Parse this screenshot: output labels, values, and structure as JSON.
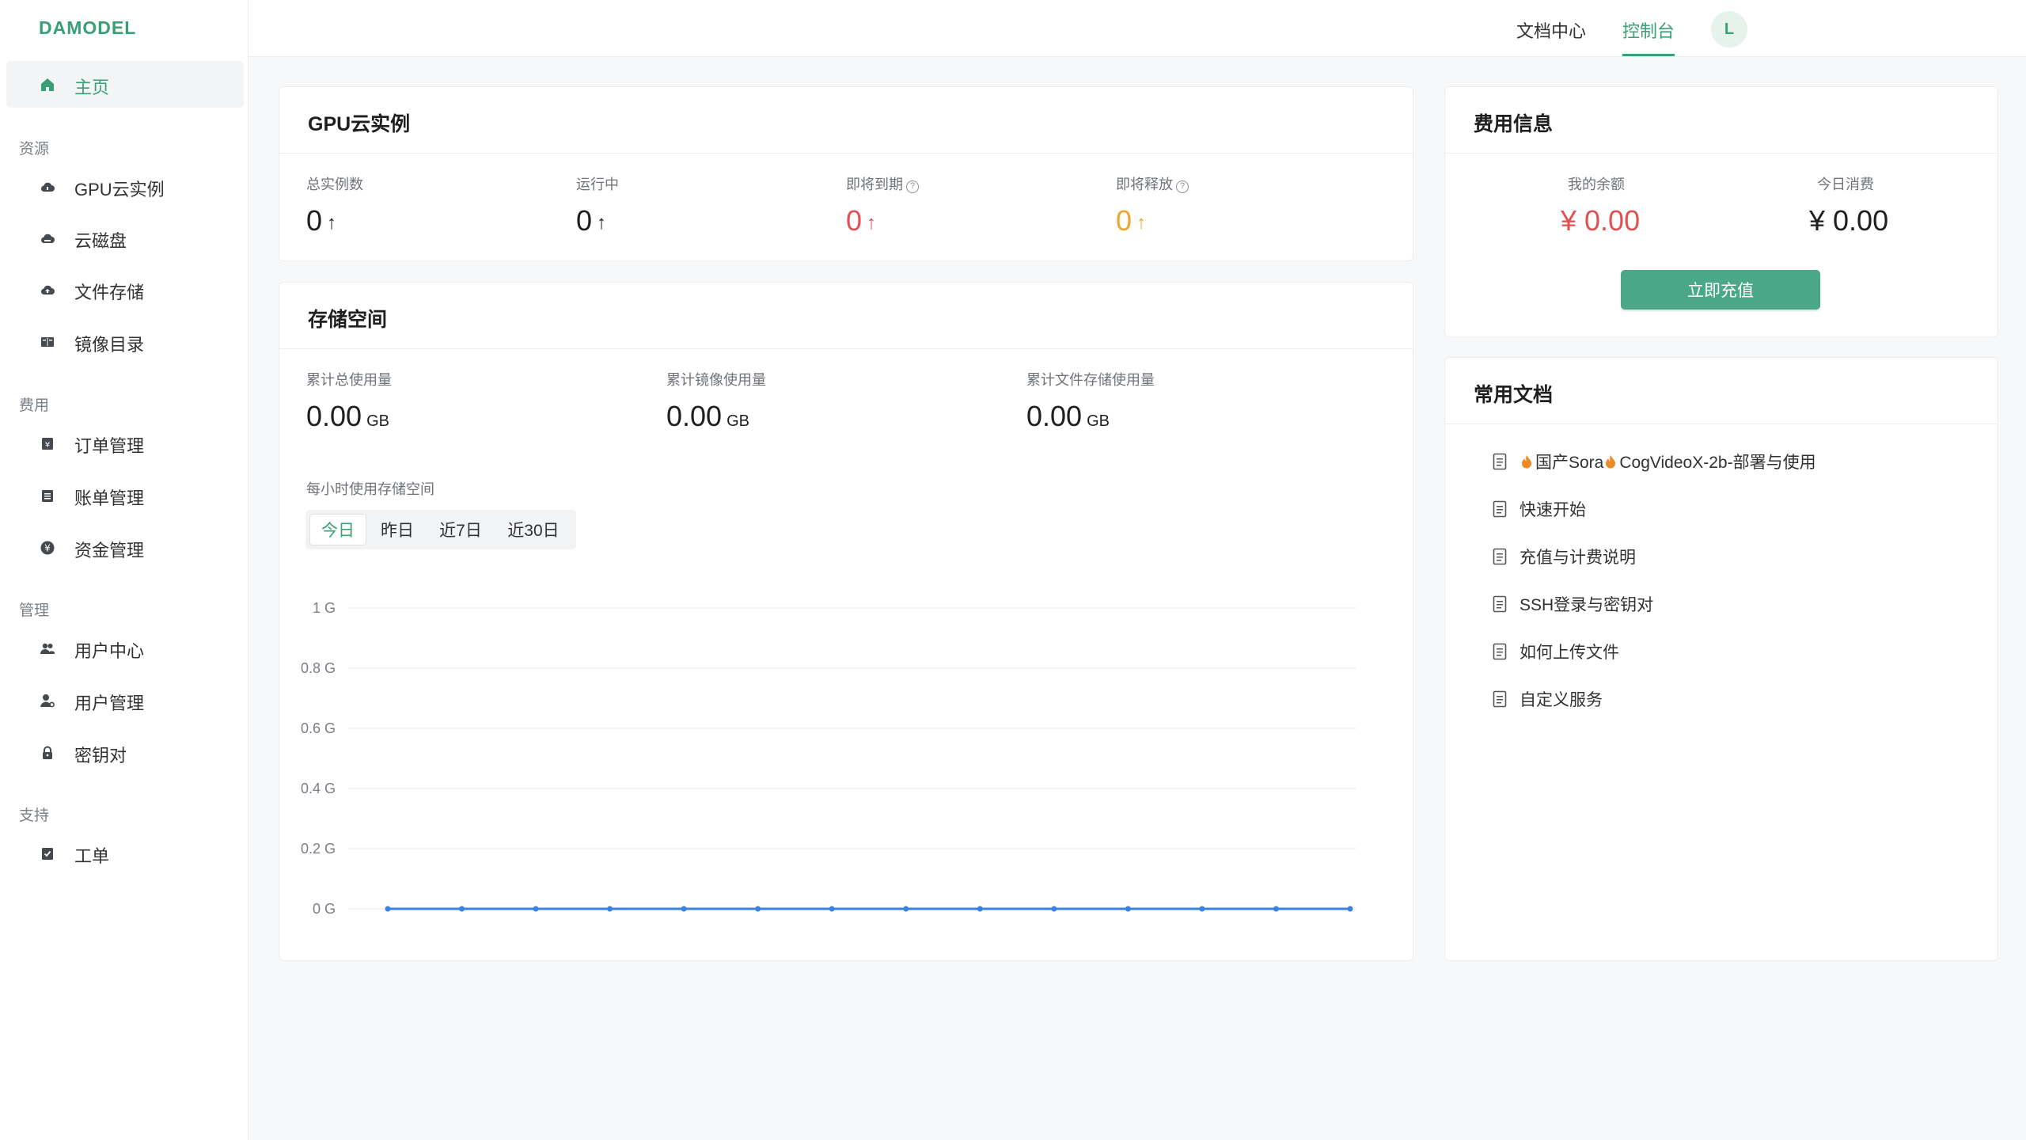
{
  "brand": {
    "logo": "DAMODEL",
    "accent": "#3a9f76"
  },
  "sidebar": {
    "home": {
      "label": "主页",
      "icon": "home-icon"
    },
    "sections": [
      {
        "title": "资源",
        "items": [
          {
            "label": "GPU云实例",
            "icon": "cloud-icon"
          },
          {
            "label": "云磁盘",
            "icon": "cloud-disk-icon"
          },
          {
            "label": "文件存储",
            "icon": "cloud-upload-icon"
          },
          {
            "label": "镜像目录",
            "icon": "book-icon"
          }
        ]
      },
      {
        "title": "费用",
        "items": [
          {
            "label": "订单管理",
            "icon": "order-icon"
          },
          {
            "label": "账单管理",
            "icon": "bill-icon"
          },
          {
            "label": "资金管理",
            "icon": "yen-icon"
          }
        ]
      },
      {
        "title": "管理",
        "items": [
          {
            "label": "用户中心",
            "icon": "users-icon"
          },
          {
            "label": "用户管理",
            "icon": "user-manage-icon"
          },
          {
            "label": "密钥对",
            "icon": "lock-icon"
          }
        ]
      },
      {
        "title": "支持",
        "items": [
          {
            "label": "工单",
            "icon": "ticket-icon"
          }
        ]
      }
    ]
  },
  "topbar": {
    "docs": "文档中心",
    "console": "控制台",
    "avatar": "L"
  },
  "gpu": {
    "title": "GPU云实例",
    "stats": [
      {
        "label": "总实例数",
        "value": "0",
        "color": "#1f1f1f",
        "help": false
      },
      {
        "label": "运行中",
        "value": "0",
        "color": "#1f1f1f",
        "help": false
      },
      {
        "label": "即将到期",
        "value": "0",
        "color": "#e05252",
        "help": true
      },
      {
        "label": "即将释放",
        "value": "0",
        "color": "#f0a531",
        "help": true
      }
    ],
    "arrow": "↑"
  },
  "storage": {
    "title": "存储空间",
    "stats": [
      {
        "label": "累计总使用量",
        "value": "0.00",
        "unit": "GB"
      },
      {
        "label": "累计镜像使用量",
        "value": "0.00",
        "unit": "GB"
      },
      {
        "label": "累计文件存储使用量",
        "value": "0.00",
        "unit": "GB"
      }
    ],
    "hourly_label": "每小时使用存储空间",
    "tabs": [
      "今日",
      "昨日",
      "近7日",
      "近30日"
    ],
    "active_tab": 0
  },
  "chart_data": {
    "type": "line",
    "y_ticks": [
      "1 G",
      "0.8 G",
      "0.6 G",
      "0.4 G",
      "0.2 G",
      "0 G"
    ],
    "ylim": [
      0,
      1
    ],
    "series": [
      {
        "values": [
          0,
          0,
          0,
          0,
          0,
          0,
          0,
          0,
          0,
          0,
          0,
          0,
          0,
          0
        ]
      }
    ],
    "line_color": "#3b82e0",
    "grid": true
  },
  "fees": {
    "title": "费用信息",
    "balance_label": "我的余额",
    "balance_value": "¥ 0.00",
    "today_label": "今日消费",
    "today_value": "¥ 0.00",
    "recharge": "立即充值"
  },
  "docs": {
    "title": "常用文档",
    "items": [
      {
        "parts": [
          "国产Sora",
          "CogVideoX-2b-部署与使用"
        ],
        "flames": true
      },
      {
        "parts": [
          "快速开始"
        ],
        "flames": false
      },
      {
        "parts": [
          "充值与计费说明"
        ],
        "flames": false
      },
      {
        "parts": [
          "SSH登录与密钥对"
        ],
        "flames": false
      },
      {
        "parts": [
          "如何上传文件"
        ],
        "flames": false
      },
      {
        "parts": [
          "自定义服务"
        ],
        "flames": false
      }
    ]
  }
}
